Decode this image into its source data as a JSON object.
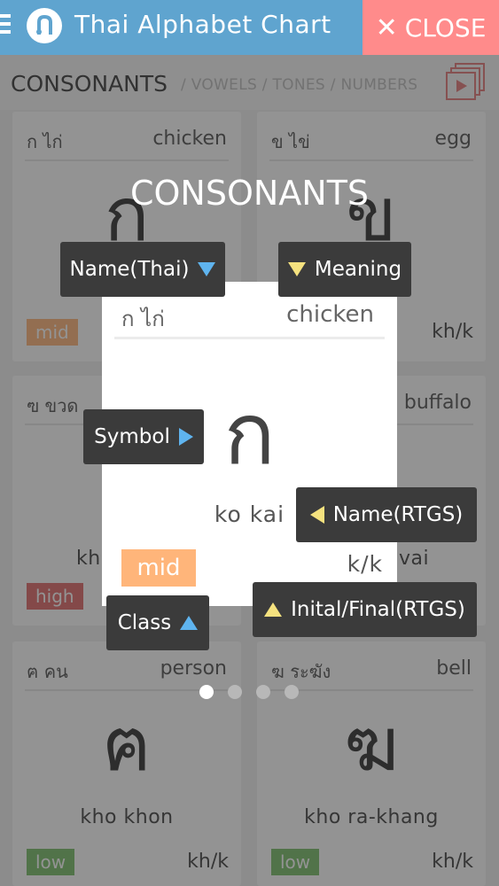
{
  "header": {
    "title": "Thai Alphabet Chart",
    "close_label": "CLOSE"
  },
  "subnav": {
    "active": "CONSONANTS",
    "others": "/ VOWELS / TONES / NUMBERS"
  },
  "cards": [
    {
      "thai": "ก ไก่",
      "meaning": "chicken",
      "symbol": "ก",
      "rtgs": "",
      "class": "mid",
      "initial_final": ""
    },
    {
      "thai": "ข ไข่",
      "meaning": "egg",
      "symbol": "ข",
      "rtgs": "",
      "class": "",
      "initial_final": "kh/k"
    },
    {
      "thai": "ฃ ขวด",
      "meaning": "",
      "symbol": "",
      "rtgs": "kh",
      "class": "high",
      "initial_final": ""
    },
    {
      "thai": "",
      "meaning": "buffalo",
      "symbol": "",
      "rtgs": "vai",
      "class": "",
      "initial_final": ""
    },
    {
      "thai": "ฅ คน",
      "meaning": "person",
      "symbol": "ฅ",
      "rtgs": "kho khon",
      "class": "low",
      "initial_final": "kh/k"
    },
    {
      "thai": "ฆ ระฆัง",
      "meaning": "bell",
      "symbol": "ฆ",
      "rtgs": "kho ra-khang",
      "class": "low",
      "initial_final": "kh/k"
    }
  ],
  "overlay": {
    "title": "CONSONANTS",
    "sample": {
      "thai": "ก ไก่",
      "meaning": "chicken",
      "symbol": "ก",
      "rtgs": "ko kai",
      "class": "mid",
      "initial_final": "k/k"
    },
    "tips": {
      "name_thai": "Name(Thai)",
      "meaning": "Meaning",
      "symbol": "Symbol",
      "name_rtgs": "Name(RTGS)",
      "class": "Class",
      "initial_final": "Inital/Final(RTGS)"
    },
    "pager": {
      "pages": 4,
      "current": 1
    }
  },
  "colors": {
    "header": "#5fa4cf",
    "close": "#ff8b8b",
    "mid": "#ffb57a",
    "high": "#e06a6a",
    "low": "#7bbf6a",
    "tooltip": "#3b3b3b"
  }
}
